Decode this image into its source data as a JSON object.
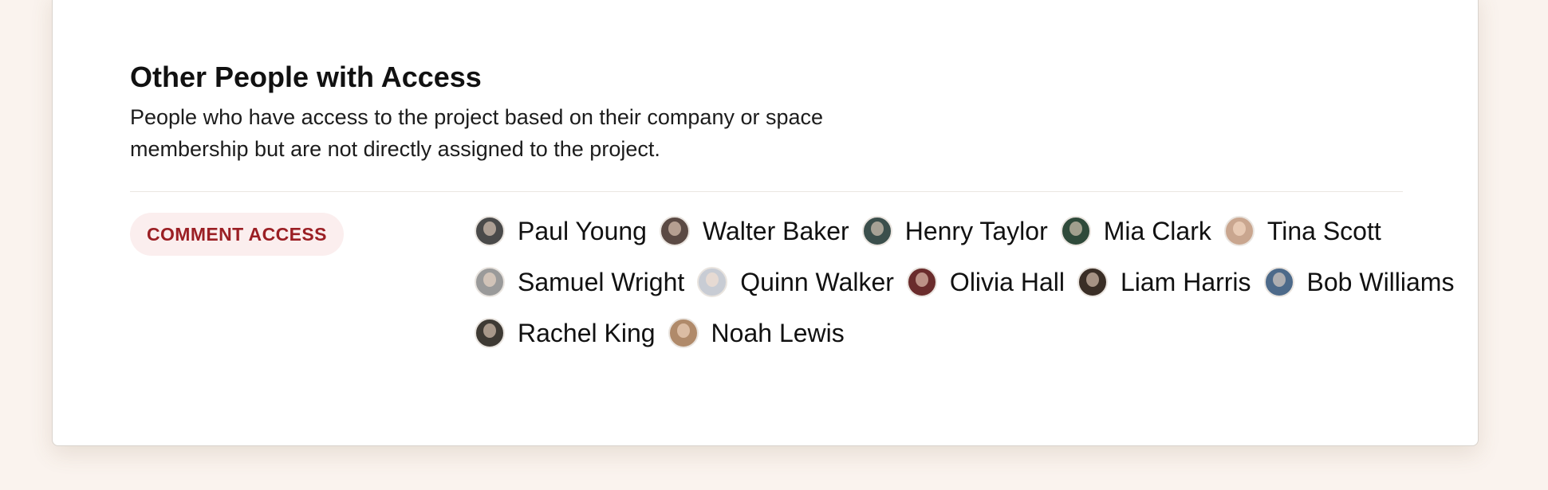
{
  "section": {
    "title": "Other People with Access",
    "description": "People who have access to the project based on their company or space membership but are not directly assigned to the project."
  },
  "access_group": {
    "badge": "COMMENT ACCESS",
    "badge_color": "#9b1f24",
    "people": [
      {
        "name": "Paul Young",
        "avatar_color": "#4a4a4a"
      },
      {
        "name": "Walter Baker",
        "avatar_color": "#5b4a44"
      },
      {
        "name": "Henry Taylor",
        "avatar_color": "#3b4f4c"
      },
      {
        "name": "Mia Clark",
        "avatar_color": "#2f4a3a"
      },
      {
        "name": "Tina Scott",
        "avatar_color": "#c9a68f"
      },
      {
        "name": "Samuel Wright",
        "avatar_color": "#9a9a9a"
      },
      {
        "name": "Quinn Walker",
        "avatar_color": "#c8ccd4"
      },
      {
        "name": "Olivia Hall",
        "avatar_color": "#6a2c2c"
      },
      {
        "name": "Liam Harris",
        "avatar_color": "#3a2e26"
      },
      {
        "name": "Bob Williams",
        "avatar_color": "#4d6a8a"
      },
      {
        "name": "Rachel King",
        "avatar_color": "#3e3a34"
      },
      {
        "name": "Noah Lewis",
        "avatar_color": "#b08a6a"
      }
    ]
  }
}
